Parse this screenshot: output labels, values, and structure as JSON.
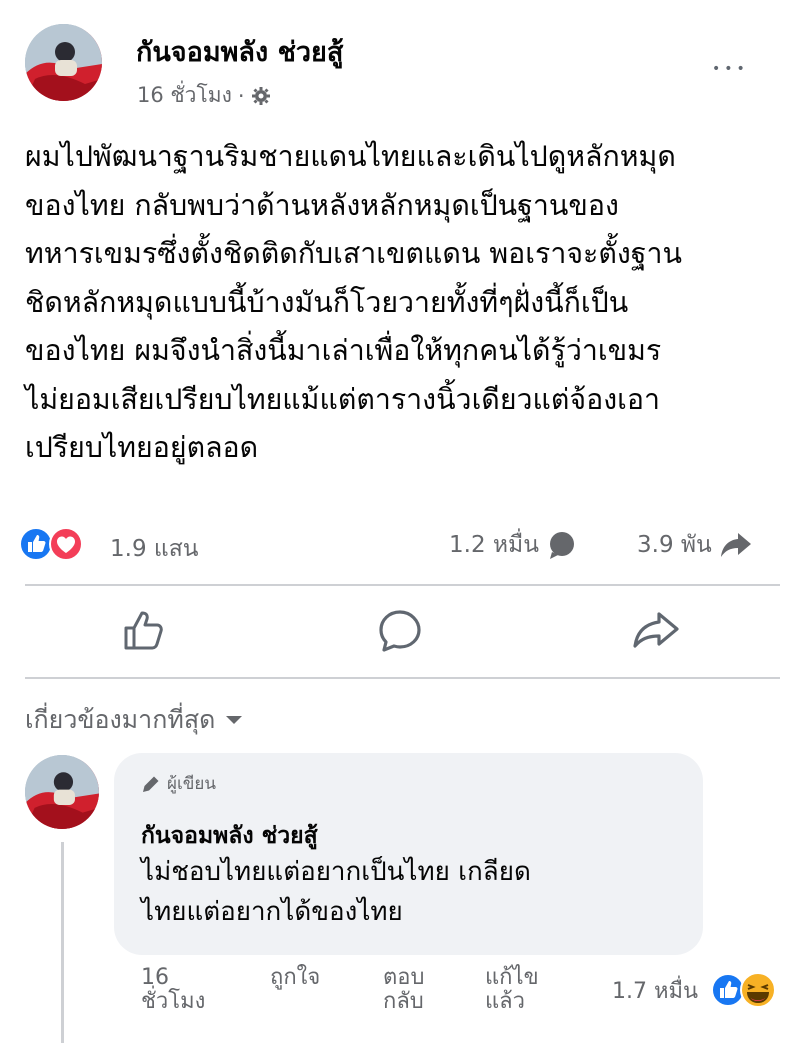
{
  "post": {
    "author": "กันจอมพลัง ช่วยสู้",
    "time": "16 ชั่วโมง",
    "separator": "·",
    "privacy_icon": "gear-icon",
    "more_icon": "more-horizontal-icon",
    "more_label": "•••",
    "text_lines": [
      "ผมไปพัฒนาฐานริมชายแดนไทยและเดินไปดูหลักหมุด",
      "ของไทย กลับพบว่าด้านหลังหลักหมุดเป็นฐานของ",
      "ทหารเขมรซึ่งตั้งชิดติดกับเสาเขตแดน พอเราจะตั้งฐาน",
      "ชิดหลักหมุดแบบนี้บ้างมันก็โวยวายทั้งที่ๆฝั่งนี้ก็เป็น",
      "ของไทย ผมจึงนำสิ่งนี้มาเล่าเพื่อให้ทุกคนได้รู้ว่าเขมร",
      "ไม่ยอมเสียเปรียบไทยแม้แต่ตารางนิ้วเดียวแต่จ้องเอา",
      "เปรียบไทยอยู่ตลอด"
    ]
  },
  "stats": {
    "reaction_icons": [
      "like-icon",
      "love-icon"
    ],
    "reactions": "1.9 แสน",
    "comments": "1.2 หมื่น",
    "comment_icon": "comment-bubble-icon",
    "shares": "3.9 พัน",
    "share_icon": "share-arrow-icon"
  },
  "actions": {
    "like_icon": "like-outline-icon",
    "comment_icon": "comment-outline-icon",
    "share_icon": "share-outline-icon"
  },
  "comments_section": {
    "filter_label": "เกี่ยวข้องมากที่สุด",
    "filter_icon": "caret-down-icon"
  },
  "comment": {
    "badge_icon": "pencil-icon",
    "badge_label": "ผู้เขียน",
    "author": "กันจอมพลัง ช่วยสู้",
    "text_lines": [
      "ไม่ชอบไทยแต่อยากเป็นไทย เกลียด",
      "ไทยแต่อยากได้ของไทย"
    ],
    "time_lines": [
      "16",
      "ชั่วโมง"
    ],
    "like_label": "ถูกใจ",
    "reply_lines": [
      "ตอบ",
      "กลับ"
    ],
    "edited_lines": [
      "แก้ไข",
      "แล้ว"
    ],
    "reaction_count": "1.7 หมื่น",
    "reaction_icons": [
      "like-icon",
      "laugh-icon"
    ]
  },
  "colors": {
    "like_blue": "#1877f2",
    "love_red": "#f33e58",
    "laugh_yellow": "#f7b125",
    "secondary_text": "#65676b"
  }
}
